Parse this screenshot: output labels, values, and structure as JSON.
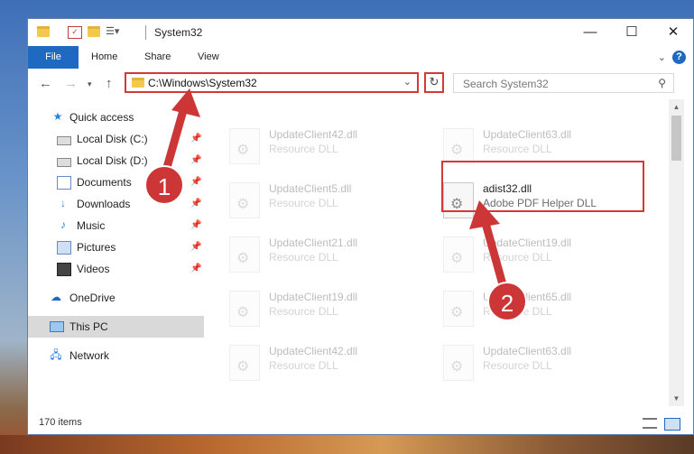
{
  "window": {
    "title": "System32"
  },
  "ribbon": {
    "file_tab": "File",
    "tabs": [
      "Home",
      "Share",
      "View"
    ],
    "help": "?"
  },
  "navigation": {
    "address": "C:\\Windows\\System32",
    "search_placeholder": "Search System32"
  },
  "sidebar": {
    "items": [
      {
        "label": "Quick access",
        "icon": "star-icon",
        "pinned": false
      },
      {
        "label": "Local Disk (C:)",
        "icon": "drive-icon",
        "pinned": true
      },
      {
        "label": "Local Disk (D:)",
        "icon": "drive-icon",
        "pinned": true
      },
      {
        "label": "Documents",
        "icon": "documents-icon",
        "pinned": true
      },
      {
        "label": "Downloads",
        "icon": "download-icon",
        "pinned": true
      },
      {
        "label": "Music",
        "icon": "music-icon",
        "pinned": true
      },
      {
        "label": "Pictures",
        "icon": "pictures-icon",
        "pinned": true
      },
      {
        "label": "Videos",
        "icon": "videos-icon",
        "pinned": true
      },
      {
        "label": "OneDrive",
        "icon": "cloud-icon",
        "pinned": false
      },
      {
        "label": "This PC",
        "icon": "computer-icon",
        "pinned": false,
        "selected": true
      },
      {
        "label": "Network",
        "icon": "network-icon",
        "pinned": false
      }
    ]
  },
  "files": [
    {
      "name": "UpdateClient42.dll",
      "desc": "Resource DLL"
    },
    {
      "name": "UpdateClient63.dll",
      "desc": "Resource DLL"
    },
    {
      "name": "UpdateClient5.dll",
      "desc": "Resource DLL"
    },
    {
      "name": "adist32.dll",
      "desc": "Adobe PDF Helper DLL"
    },
    {
      "name": "UpdateClient21.dll",
      "desc": "Resource DLL"
    },
    {
      "name": "UpdateClient19.dll",
      "desc": "Resource DLL"
    },
    {
      "name": "UpdateClient19.dll",
      "desc": "Resource DLL"
    },
    {
      "name": "UpdateClient65.dll",
      "desc": "Resource DLL"
    },
    {
      "name": "UpdateClient42.dll",
      "desc": "Resource DLL"
    },
    {
      "name": "UpdateClient63.dll",
      "desc": "Resource DLL"
    }
  ],
  "status": {
    "item_count": "170 items"
  },
  "annotations": {
    "step1": "1",
    "step2": "2",
    "color": "#cd3636"
  }
}
